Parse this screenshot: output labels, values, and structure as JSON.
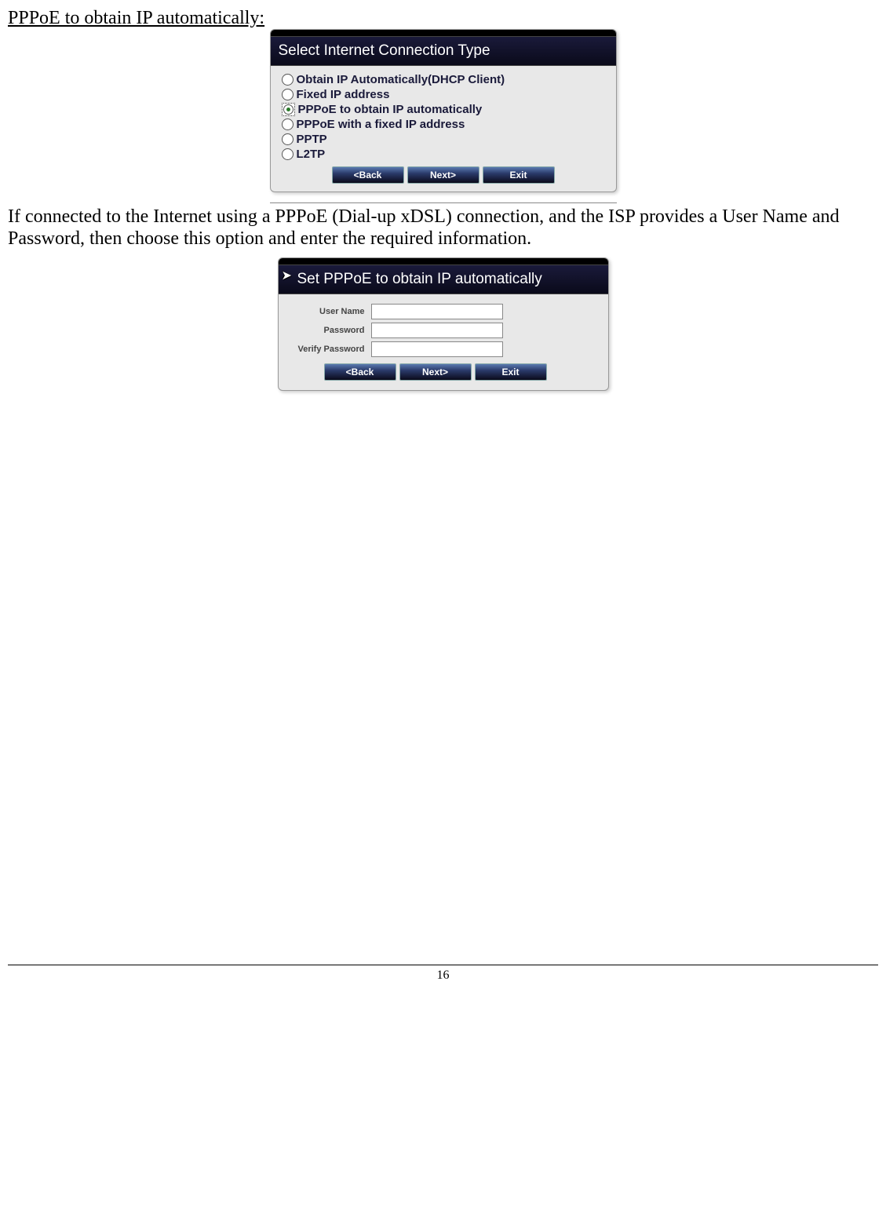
{
  "heading": "PPPoE to obtain IP automatically:",
  "dialog1": {
    "title": "Select Internet Connection Type",
    "options": [
      "Obtain IP Automatically(DHCP Client)",
      "Fixed IP address",
      "PPPoE to obtain IP automatically",
      "PPPoE with a fixed IP address",
      "PPTP",
      "L2TP"
    ],
    "selected_index": 2,
    "buttons": {
      "back": "<Back",
      "next": "Next>",
      "exit": "Exit"
    }
  },
  "paragraph": "If connected to the Internet using a PPPoE (Dial-up xDSL) connection, and the ISP provides a User Name and Password, then choose this option and enter the required information.",
  "dialog2": {
    "title": "Set PPPoE to obtain IP automatically",
    "fields": {
      "username_label": "User Name",
      "username_value": "",
      "password_label": "Password",
      "password_value": "",
      "verify_label": "Verify Password",
      "verify_value": ""
    },
    "buttons": {
      "back": "<Back",
      "next": "Next>",
      "exit": "Exit"
    }
  },
  "page_number": "16"
}
